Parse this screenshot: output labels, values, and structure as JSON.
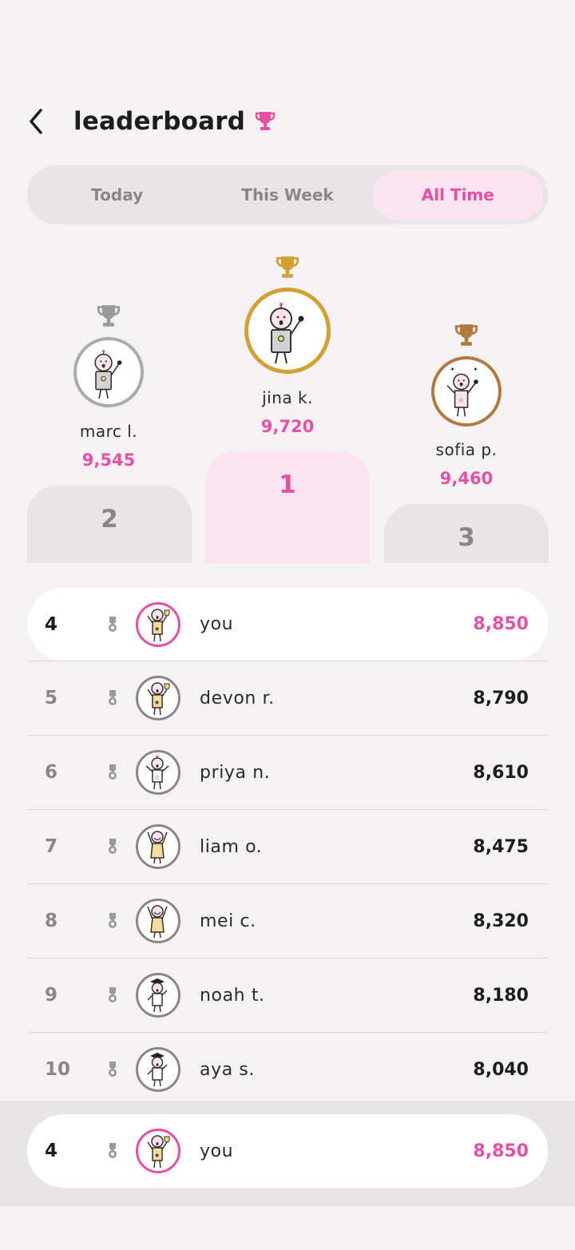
{
  "header": {
    "title": "leaderboard"
  },
  "tabs": [
    {
      "label": "Today",
      "active": false
    },
    {
      "label": "This Week",
      "active": false
    },
    {
      "label": "All Time",
      "active": true
    }
  ],
  "podium": {
    "first": {
      "name": "jina k.",
      "score": "9,720",
      "rank": "1"
    },
    "second": {
      "name": "marc l.",
      "score": "9,545",
      "rank": "2"
    },
    "third": {
      "name": "sofia p.",
      "score": "9,460",
      "rank": "3"
    }
  },
  "list": [
    {
      "rank": "4",
      "name": "you",
      "score": "8,850",
      "me": true
    },
    {
      "rank": "5",
      "name": "devon r.",
      "score": "8,790"
    },
    {
      "rank": "6",
      "name": "priya n.",
      "score": "8,610"
    },
    {
      "rank": "7",
      "name": "liam o.",
      "score": "8,475"
    },
    {
      "rank": "8",
      "name": "mei c.",
      "score": "8,320"
    },
    {
      "rank": "9",
      "name": "noah t.",
      "score": "8,180"
    },
    {
      "rank": "10",
      "name": "aya s.",
      "score": "8,040"
    }
  ],
  "sticky": {
    "rank": "4",
    "name": "you",
    "score": "8,850"
  },
  "colors": {
    "accent": "#e84fa3",
    "gold": "#d4a032",
    "silver": "#9a9a9a",
    "bronze": "#b07a3c"
  },
  "icons": [
    "back-chevron-icon",
    "trophy-icon",
    "medal-icon",
    "avatar-icon"
  ]
}
